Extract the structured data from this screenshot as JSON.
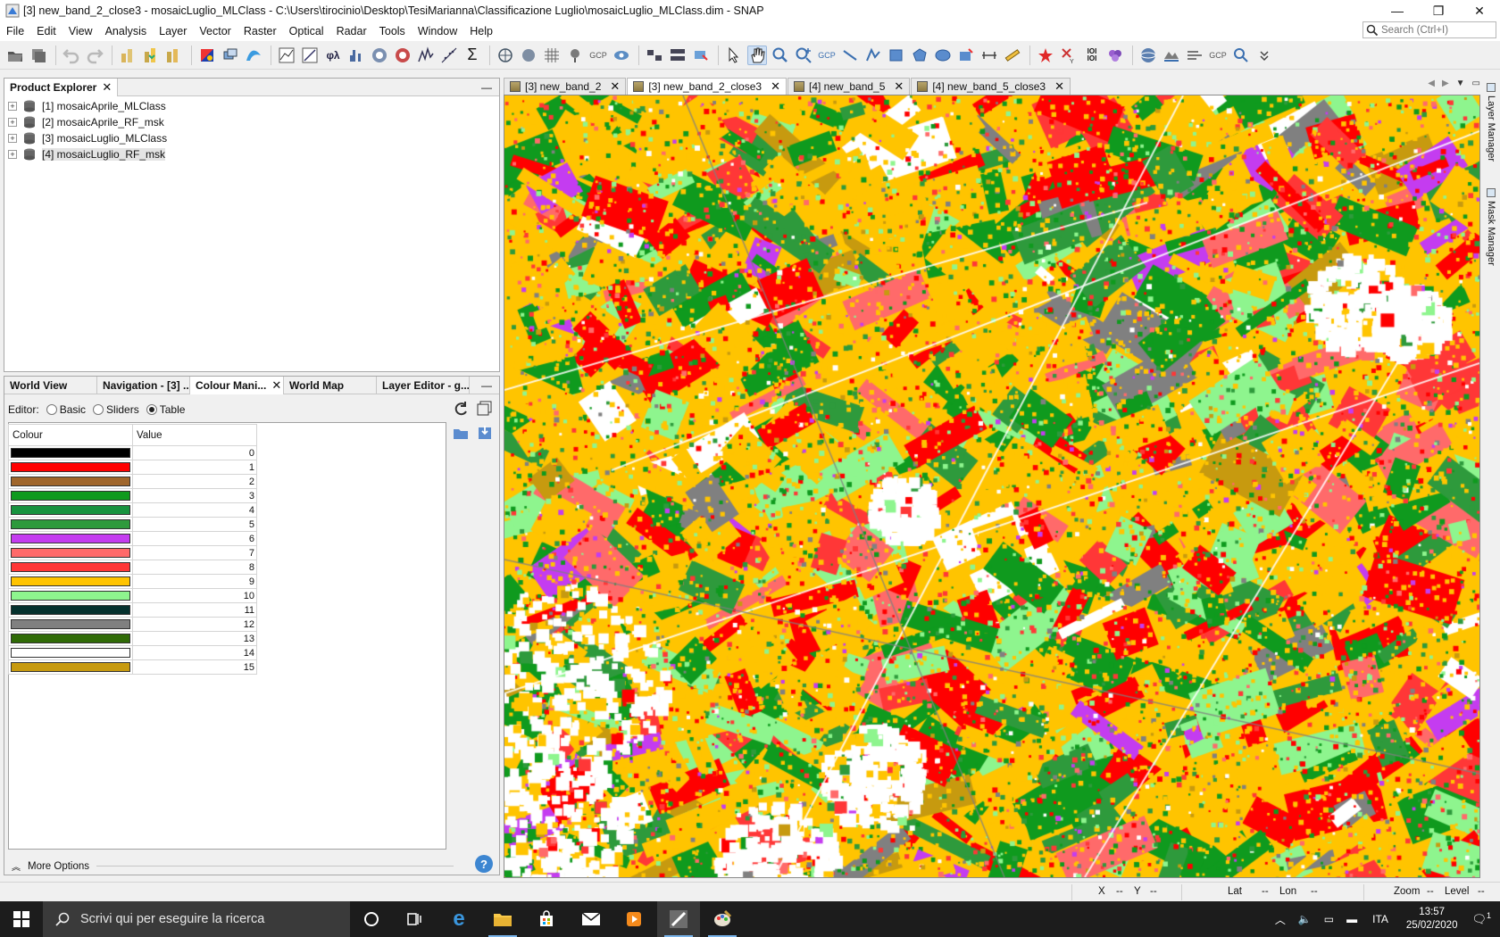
{
  "window": {
    "title": "[3] new_band_2_close3 - mosaicLuglio_MLClass - C:\\Users\\tirocinio\\Desktop\\TesiMarianna\\Classificazione Luglio\\mosaicLuglio_MLClass.dim - SNAP",
    "minimize": "—",
    "maximize": "❐",
    "close": "✕"
  },
  "menu": [
    "File",
    "Edit",
    "View",
    "Analysis",
    "Layer",
    "Vector",
    "Raster",
    "Optical",
    "Radar",
    "Tools",
    "Window",
    "Help"
  ],
  "search": {
    "placeholder": "Search (Ctrl+I)"
  },
  "toolbar": {
    "gcp_labels": [
      "GCP",
      "GCP",
      "GCP"
    ],
    "spectrum_label": "φλ",
    "sum_label": "Σ",
    "ioi_label": "IOI\nIOI"
  },
  "product_explorer": {
    "title": "Product Explorer",
    "products": [
      {
        "label": "[1] mosaicAprile_MLClass",
        "selected": false
      },
      {
        "label": "[2] mosaicAprile_RF_msk",
        "selected": false
      },
      {
        "label": "[3] mosaicLuglio_MLClass",
        "selected": false
      },
      {
        "label": "[4] mosaicLuglio_RF_msk",
        "selected": true
      }
    ]
  },
  "tool_tabs": [
    "World View",
    "Navigation - [3] ...",
    "Colour Mani...",
    "World Map",
    "Layer Editor - g..."
  ],
  "colour_editor": {
    "editor_label": "Editor:",
    "modes": [
      "Basic",
      "Sliders",
      "Table"
    ],
    "selected_mode": "Table",
    "col_colour": "Colour",
    "col_value": "Value",
    "rows": [
      {
        "color": "#000000",
        "value": "0"
      },
      {
        "color": "#ff0000",
        "value": "1"
      },
      {
        "color": "#a0662b",
        "value": "2"
      },
      {
        "color": "#0f9a1e",
        "value": "3"
      },
      {
        "color": "#17933f",
        "value": "4"
      },
      {
        "color": "#2e9a3c",
        "value": "5"
      },
      {
        "color": "#c43cf0",
        "value": "6"
      },
      {
        "color": "#ff6a6a",
        "value": "7"
      },
      {
        "color": "#ff3737",
        "value": "8"
      },
      {
        "color": "#ffc400",
        "value": "9"
      },
      {
        "color": "#8ef58e",
        "value": "10"
      },
      {
        "color": "#05312e",
        "value": "11"
      },
      {
        "color": "#808080",
        "value": "12"
      },
      {
        "color": "#2f6a06",
        "value": "13"
      },
      {
        "color": "#ffffff",
        "value": "14"
      },
      {
        "color": "#c79a0f",
        "value": "15"
      }
    ],
    "more_options": "More Options",
    "help": "?"
  },
  "image_tabs": [
    {
      "label": "[3] new_band_2",
      "selected": false
    },
    {
      "label": "[3] new_band_2_close3",
      "selected": true
    },
    {
      "label": "[4] new_band_5",
      "selected": false
    },
    {
      "label": "[4] new_band_5_close3",
      "selected": false
    }
  ],
  "side_tools": [
    "Layer Manager",
    "Mask Manager"
  ],
  "status": {
    "x_label": "X",
    "x_value": "--",
    "y_label": "Y",
    "y_value": "--",
    "lat_label": "Lat",
    "lat_value": "--",
    "lon_label": "Lon",
    "lon_value": "--",
    "zoom_label": "Zoom",
    "zoom_value": "--",
    "level_label": "Level",
    "level_value": "--"
  },
  "taskbar": {
    "search_placeholder": "Scrivi qui per eseguire la ricerca",
    "language": "ITA",
    "time": "13:57",
    "date": "25/02/2020",
    "notifications": "1"
  }
}
